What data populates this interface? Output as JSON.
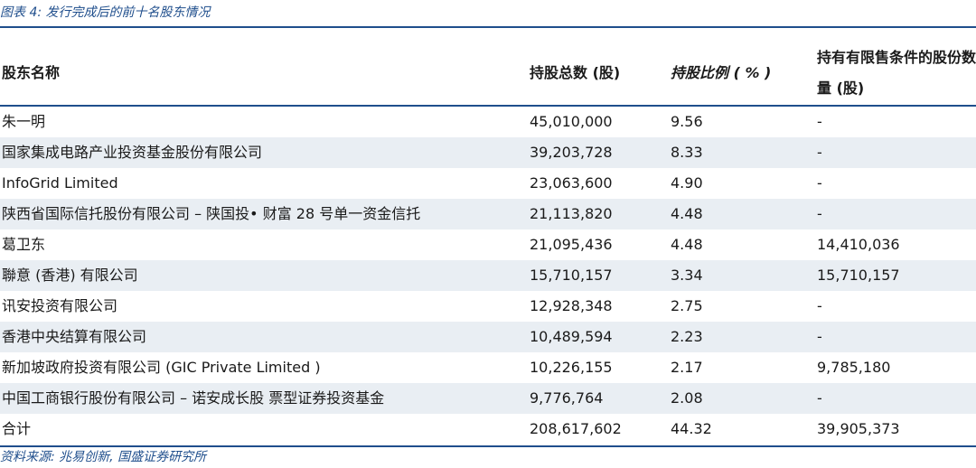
{
  "title": "图表 4:  发行完成后的前十名股东情况",
  "source": "资料来源:  兆易创新, 国盛证券研究所",
  "table": {
    "headers": {
      "name": "股东名称",
      "shares": "持股总数 (股)",
      "pct": "持股比例 ( % )",
      "restricted": "持有有限售条件的股份数量 (股)"
    },
    "rows": [
      {
        "name": "朱一明",
        "shares": "45,010,000",
        "pct": "9.56",
        "restricted": "-"
      },
      {
        "name": "国家集成电路产业投资基金股份有限公司",
        "shares": "39,203,728",
        "pct": "8.33",
        "restricted": "-"
      },
      {
        "name": "InfoGrid Limited",
        "shares": "23,063,600",
        "pct": "4.90",
        "restricted": "-"
      },
      {
        "name": "陕西省国际信托股份有限公司 – 陕国投• 财富 28 号单一资金信托",
        "shares": "21,113,820",
        "pct": "4.48",
        "restricted": "-"
      },
      {
        "name": "葛卫东",
        "shares": "21,095,436",
        "pct": "4.48",
        "restricted": "14,410,036"
      },
      {
        "name": "聯意 (香港) 有限公司",
        "shares": "15,710,157",
        "pct": "3.34",
        "restricted": "15,710,157"
      },
      {
        "name": "讯安投资有限公司",
        "shares": "12,928,348",
        "pct": "2.75",
        "restricted": "-"
      },
      {
        "name": "香港中央结算有限公司",
        "shares": "10,489,594",
        "pct": "2.23",
        "restricted": "-"
      },
      {
        "name": "新加坡政府投资有限公司 (GIC Private Limited )",
        "shares": "10,226,155",
        "pct": "2.17",
        "restricted": "9,785,180"
      },
      {
        "name": "中国工商银行股份有限公司 – 诺安成长股 票型证券投资基金",
        "shares": "9,776,764",
        "pct": "2.08",
        "restricted": "-"
      },
      {
        "name": "合计",
        "shares": "208,617,602",
        "pct": "44.32",
        "restricted": "39,905,373"
      }
    ]
  }
}
